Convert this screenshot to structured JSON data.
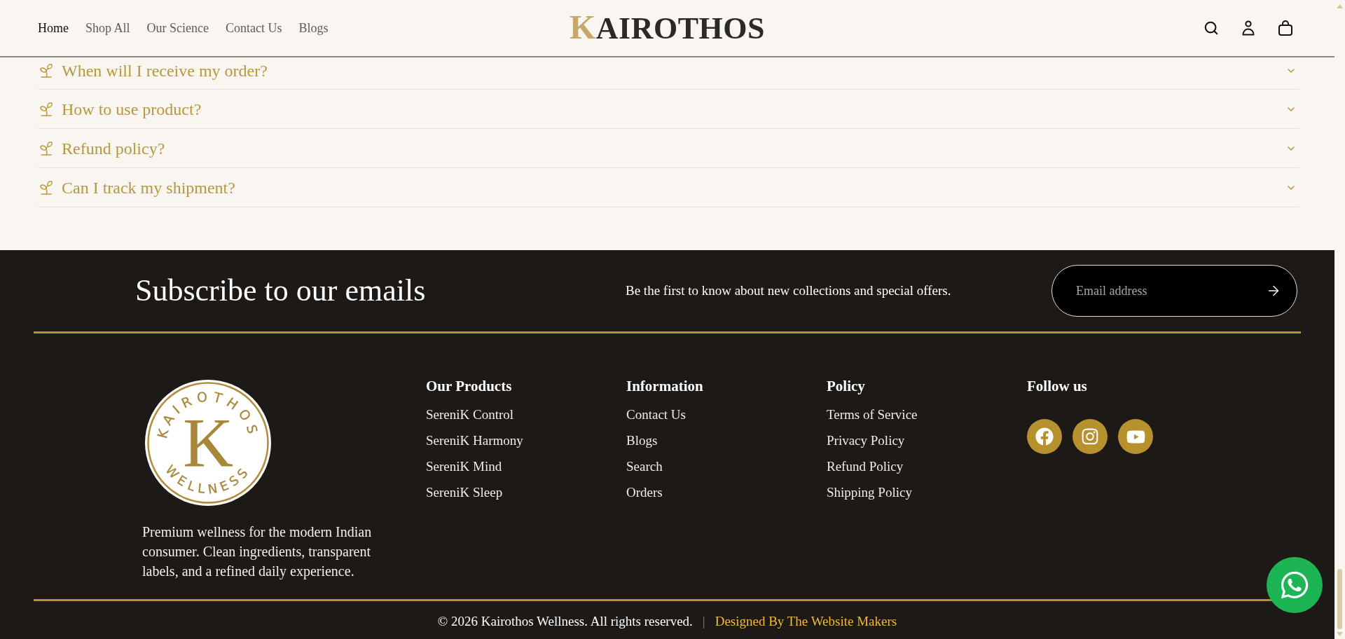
{
  "header": {
    "nav": [
      {
        "label": "Home",
        "selected": true
      },
      {
        "label": "Shop All",
        "selected": false
      },
      {
        "label": "Our Science",
        "selected": false
      },
      {
        "label": "Contact Us",
        "selected": false
      },
      {
        "label": "Blogs",
        "selected": false
      }
    ],
    "logo": {
      "initial": "K",
      "rest": "AIROTHOS"
    }
  },
  "faq": [
    {
      "question": "When will I receive my order?",
      "expanded": false
    },
    {
      "question": "How to use product?",
      "expanded": false
    },
    {
      "question": "Refund policy?",
      "expanded": false
    },
    {
      "question": "Can I track my shipment?",
      "expanded": false
    }
  ],
  "subscribe": {
    "title": "Subscribe to our emails",
    "description": "Be the first to know about new collections and special offers.",
    "email_field": {
      "placeholder": "Email address"
    }
  },
  "footer": {
    "badge": {
      "top_text": "KAIROTHOS",
      "initial": "K",
      "bottom_text": "WELLNESS"
    },
    "about": "Premium wellness for the modern Indian consumer. Clean ingredients, transparent labels, and a refined daily experience.",
    "columns": [
      {
        "title": "Our Products",
        "links": [
          "SereniK Control",
          "SereniK Harmony",
          "SereniK Mind",
          "SereniK Sleep"
        ]
      },
      {
        "title": "Information",
        "links": [
          "Contact Us",
          "Blogs",
          "Search",
          "Orders"
        ]
      },
      {
        "title": "Policy",
        "links": [
          "Terms of Service",
          "Privacy Policy",
          "Refund Policy",
          "Shipping Policy"
        ]
      }
    ],
    "follow": {
      "title": "Follow us",
      "socials": [
        {
          "kind": "facebook"
        },
        {
          "kind": "instagram"
        },
        {
          "kind": "youtube"
        }
      ]
    }
  },
  "bottom_bar": {
    "copyright": "© 2026 Kairothos Wellness. All rights reserved.",
    "separator": "|",
    "credit": "Designed By The Website Makers"
  }
}
